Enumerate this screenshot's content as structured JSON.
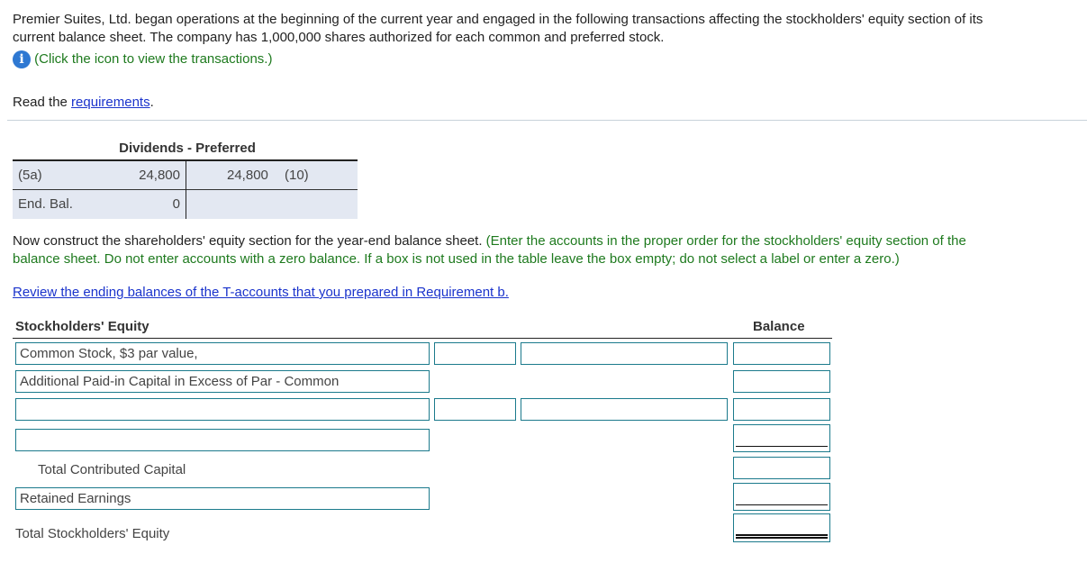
{
  "intro": {
    "line1": "Premier Suites, Ltd. began operations at the beginning of the current year and engaged in the following transactions affecting the stockholders' equity section of its",
    "line2": "current balance sheet. The company has 1,000,000 shares authorized for each common and preferred stock.",
    "info_icon": "info-icon",
    "info_text": "(Click the icon to view the transactions.)"
  },
  "requirements": {
    "prefix": "Read the ",
    "link": "requirements",
    "suffix": "."
  },
  "t_account": {
    "title": "Dividends - Preferred",
    "rows": [
      {
        "label": "(5a)",
        "debit": "24,800",
        "credit": "24,800",
        "credit_ref": "(10)"
      },
      {
        "label": "End. Bal.",
        "debit": "0",
        "credit": "",
        "credit_ref": ""
      }
    ]
  },
  "instructions": {
    "lead": "Now construct the shareholders' equity section for the year-end balance sheet. ",
    "green_line1": "(Enter the accounts in the proper order for the stockholders' equity section of the",
    "green_line2": "balance sheet. Do not enter accounts with a zero balance. If a box is not used in the table leave the box empty; do not select a label or enter a zero.)",
    "review_link": "Review the ending balances of the T-accounts that you prepared in Requirement b."
  },
  "equity": {
    "header": "Stockholders' Equity",
    "balance_header": "Balance",
    "rows": [
      {
        "account": "Common Stock, $3 par value,",
        "col1": "",
        "col2": "",
        "balance": ""
      },
      {
        "account": "Additional Paid-in Capital in Excess of Par - Common",
        "balance": ""
      },
      {
        "account": "",
        "col1": "",
        "col2": "",
        "balance": ""
      },
      {
        "account": "",
        "balance": ""
      },
      {
        "label": "Total Contributed Capital",
        "balance": ""
      },
      {
        "account": "Retained Earnings",
        "balance": ""
      },
      {
        "label": "Total Stockholders' Equity",
        "balance": ""
      }
    ]
  }
}
